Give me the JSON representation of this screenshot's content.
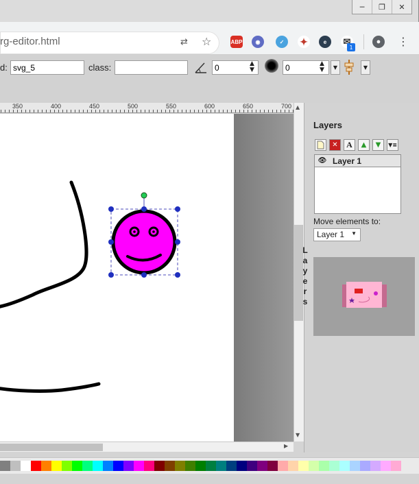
{
  "window": {
    "controls": [
      "minimize-icon",
      "restore-icon",
      "close-icon"
    ]
  },
  "browser": {
    "url": "rg-editor.html",
    "toolbar_icons": [
      "translate-icon",
      "star-icon",
      "adblock-icon",
      "extension-icon",
      "extension-icon-2",
      "acrobat-icon",
      "edge-icon",
      "notification-icon",
      "account-icon",
      "menu-icon"
    ],
    "abp_label": "ABP",
    "notification_count": "1"
  },
  "editor": {
    "id_label": "d:",
    "id_value": "svg_5",
    "class_label": "class:",
    "class_value": "",
    "angle_value": "0",
    "blur_value": "0"
  },
  "ruler": {
    "labels": [
      "350",
      "400",
      "450",
      "500",
      "550",
      "600",
      "650",
      "700"
    ]
  },
  "layers": {
    "title": "Layers",
    "layer_names": [
      "Layer 1"
    ],
    "move_label": "Move elements to:",
    "move_value": "Layer 1",
    "sidebar_tab": "Layers"
  },
  "palette": {
    "colors": [
      "#808080",
      "#bfbfbf",
      "#ffffff",
      "#ff0000",
      "#ff7f00",
      "#ffff00",
      "#7fff00",
      "#00ff00",
      "#00ff7f",
      "#00ffff",
      "#007fff",
      "#0000ff",
      "#7f00ff",
      "#ff00ff",
      "#ff007f",
      "#7f0000",
      "#7f3f00",
      "#7f7f00",
      "#3f7f00",
      "#007f00",
      "#007f3f",
      "#007f7f",
      "#003f7f",
      "#00007f",
      "#3f007f",
      "#7f007f",
      "#7f003f",
      "#ffaaaa",
      "#ffd4aa",
      "#ffffaa",
      "#d4ffaa",
      "#aaffaa",
      "#aaffd4",
      "#aaffff",
      "#aad4ff",
      "#aaaaff",
      "#d4aaff",
      "#ffaaff",
      "#ffaad4"
    ]
  },
  "colors": {
    "smiley_fill": "#ff00ff",
    "selection_handle": "#1f2fbf",
    "rotate_handle": "#22cc55"
  }
}
